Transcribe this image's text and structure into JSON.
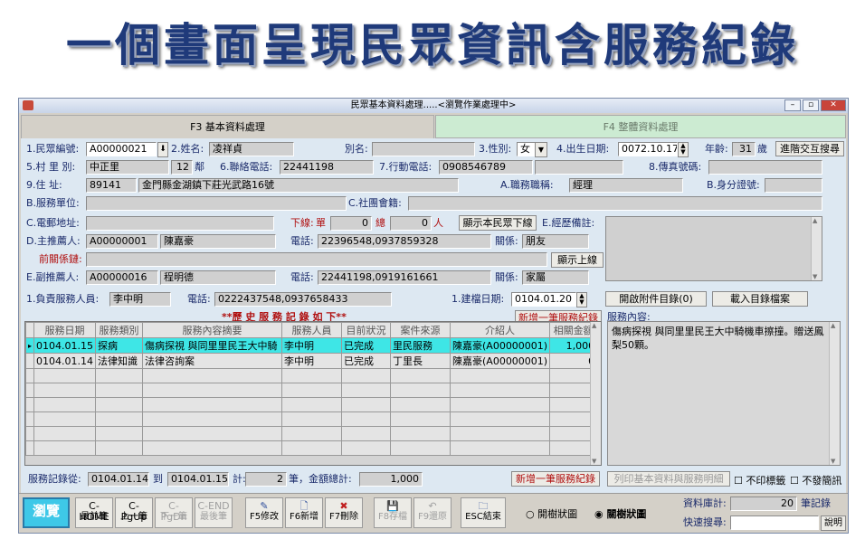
{
  "headline": "一個畫面呈現民眾資訊含服務紀錄",
  "window": {
    "title": "民眾基本資料處理.....<瀏覽作業處理中>",
    "minimize": "–",
    "restore": "▫",
    "close": "✕"
  },
  "tabs": [
    {
      "label": "F3 基本資料處理"
    },
    {
      "label": "F4 整體資料處理"
    }
  ],
  "form": {
    "citizen_id_label": "1.民眾編號:",
    "citizen_id": "A00000021",
    "name_label": "2.姓名:",
    "name": "凌祥貞",
    "alias_label": "別名:",
    "alias": "",
    "gender_label": "3.性別:",
    "gender": "女",
    "birth_label": "4.出生日期:",
    "birth": "0072.10.17",
    "age_label": "年齡:",
    "age": "31",
    "age_unit": "歲",
    "advanced_search": "進階交互搜尋",
    "village_label": "5.村 里 別:",
    "village": "中正里",
    "neighborhood": "12",
    "neighborhood_unit": "鄰",
    "phone_label": "6.聯絡電話:",
    "phone": "22441198",
    "mobile_label": "7.行動電話:",
    "mobile": "0908546789",
    "fax_label": "8.傳真號碼:",
    "fax": "",
    "address_label": "9.住 址:",
    "zip": "89141",
    "address": "金門縣金湖鎮下莊光武路16號",
    "job_title_label": "A.職務職稱:",
    "job_title": "經理",
    "id_number_label": "B.身分證號:",
    "id_number": "",
    "work_unit_label": "B.服務單位:",
    "work_unit": "",
    "association_label": "C.社團會籍:",
    "association": "",
    "email_label": "C.電郵地址:",
    "email": "",
    "downline_label": "下線:",
    "downline_single_label": "單",
    "downline_single": "0",
    "downline_total_label": "總",
    "downline_total": "0",
    "downline_unit": "人",
    "show_downline": "顯示本民眾下線",
    "economic_note_label": "E.經歷備註:",
    "recommender_label": "D.主推薦人:",
    "recommender_id": "A00000001",
    "recommender_name": "陳嘉豪",
    "recommender_phone_label": "電話:",
    "recommender_phone": "22396548,0937859328",
    "recommender_relation_label": "關係:",
    "recommender_relation": "朋友",
    "relation_chain_label": "前關係鏈:",
    "relation_chain": "",
    "show_upline": "顯示上線",
    "sub_recommender_label": "E.副推薦人:",
    "sub_recommender_id": "A00000016",
    "sub_recommender_name": "程明德",
    "sub_phone_label": "電話:",
    "sub_phone": "22441198,0919161661",
    "sub_relation_label": "關係:",
    "sub_relation": "家屬",
    "staff_label": "1.負責服務人員:",
    "staff": "李中明",
    "staff_phone_label": "電話:",
    "staff_phone": "0222437548,0937658433",
    "file_date_label": "1.建檔日期:",
    "file_date": "0104.01.20",
    "open_attachments": "開啟附件目錄(0)",
    "load_catalog": "載入目錄檔案"
  },
  "history": {
    "title": "**歷 史 服 務 記 錄 如 下**",
    "add_record_top": "新增一筆服務紀錄",
    "content_label": "服務內容:",
    "content": "傷病探視 與同里里民王大中騎機車擦撞。贈送鳳梨50顆。",
    "columns": [
      "服務日期",
      "服務類別",
      "服務內容摘要",
      "服務人員",
      "目前狀況",
      "案件來源",
      "介紹人",
      "相關金額"
    ],
    "rows": [
      [
        "0104.01.15",
        "探病",
        "傷病探視 與同里里民王大中騎",
        "李中明",
        "已完成",
        "里民服務",
        "陳嘉豪(A00000001)",
        "1,000"
      ],
      [
        "0104.01.14",
        "法律知識",
        "法律咨詢案",
        "李中明",
        "已完成",
        "丁里長",
        "陳嘉豪(A00000001)",
        "0"
      ]
    ],
    "range_label": "服務記錄從:",
    "range_from": "0104.01.14",
    "range_to_label": "到",
    "range_to": "0104.01.15",
    "count_label": "計:",
    "count": "2",
    "sum_label": "筆，金額總計:",
    "sum": "1,000",
    "add_record_bottom": "新增一筆服務紀錄",
    "print_detail": "列印基本資料與服務明細",
    "no_label": "不印標籤",
    "no_brief": "不發簡訊"
  },
  "toolbar": {
    "browse": "瀏覽",
    "buttons": [
      {
        "top": "C-HOME",
        "bottom": "最前筆"
      },
      {
        "top": "C-PgUp",
        "bottom": "上一筆"
      },
      {
        "top": "C-PgDn",
        "bottom": "下一筆"
      },
      {
        "top": "C-END",
        "bottom": "最後筆"
      },
      {
        "top": "✎",
        "bottom": "F5修改"
      },
      {
        "top": "🗋",
        "bottom": "F6新增"
      },
      {
        "top": "✖",
        "bottom": "F7刪除"
      },
      {
        "top": "💾",
        "bottom": "F8存檔"
      },
      {
        "top": "↶",
        "bottom": "F9還原"
      },
      {
        "top": "🗀",
        "bottom": "ESC結束"
      }
    ],
    "radio_open": "開樹狀圖",
    "radio_close": "關樹狀圖",
    "db_count_label": "資料庫計:",
    "db_count": "20",
    "db_count_unit": "筆記錄",
    "quick_search_label": "快速搜尋:",
    "quick_search": "",
    "help": "說明"
  },
  "colors": {
    "selected_row": "#3ee6e6",
    "headline": "#1f3a7a",
    "panel": "#dde8f2",
    "tab2": "#ccebd2"
  }
}
